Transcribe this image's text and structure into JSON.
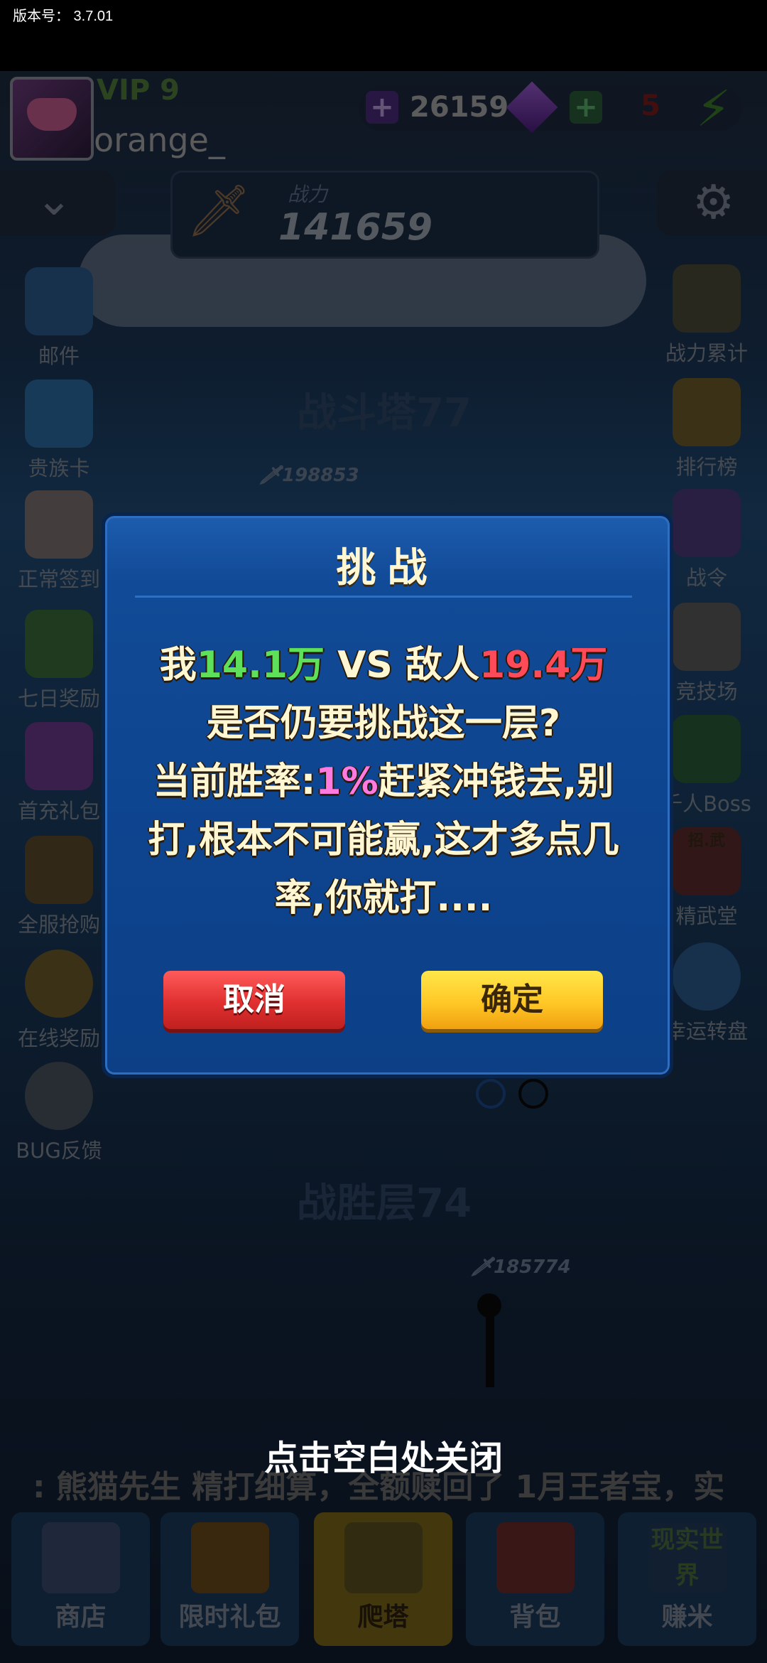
{
  "version_label": "版本号： 3.7.01",
  "player": {
    "vip": "VIP 9",
    "name": "orange_"
  },
  "resources": {
    "purple_plus": "+",
    "purple_value": "26159",
    "green_plus": "+",
    "energy_value": "5"
  },
  "power": {
    "label": "战力",
    "value": "141659"
  },
  "tower": {
    "upper_floor": "战斗塔77",
    "upper_enemy_power": "198853",
    "lower_floor": "战胜层74",
    "lower_enemy_power": "185774"
  },
  "left_menu": [
    "邮件",
    "贵族卡",
    "正常签到",
    "七日奖励",
    "首充礼包",
    "全服抢购",
    "在线奖励",
    "BUG反馈"
  ],
  "right_menu": [
    "战力累计",
    "排行榜",
    "战令",
    "竞技场",
    "千人Boss",
    "精武堂",
    "幸运转盘"
  ],
  "right_menu_sign": "招.武",
  "dialog": {
    "title": "挑战",
    "line1_a": "我",
    "line1_b": "14.1万",
    "line1_c": " VS 敌人",
    "line1_d": "19.4万",
    "line2": "是否仍要挑战这一层?",
    "line3_a": "当前胜率:",
    "line3_b": "1%",
    "line3_c": "赶紧冲钱去,别",
    "line4": "打,根本不可能赢,这才多点几",
    "line5": "率,你就打....",
    "cancel": "取消",
    "confirm": "确定"
  },
  "close_hint": "点击空白处关闭",
  "ticker": ": 熊猫先生 精打细算，全额赎回了 1月王者宝，实",
  "bottom_nav": [
    "商店",
    "限时礼包",
    "爬塔",
    "背包",
    "赚米"
  ],
  "bottom_nav_badge": "现实世界",
  "colors": {
    "dialog_bg": "#0e4590",
    "cancel": "#e03030",
    "confirm": "#ffc826",
    "highlight_green": "#5fe05a",
    "highlight_red": "#ff4a5a",
    "highlight_pink": "#ff7ae0"
  }
}
